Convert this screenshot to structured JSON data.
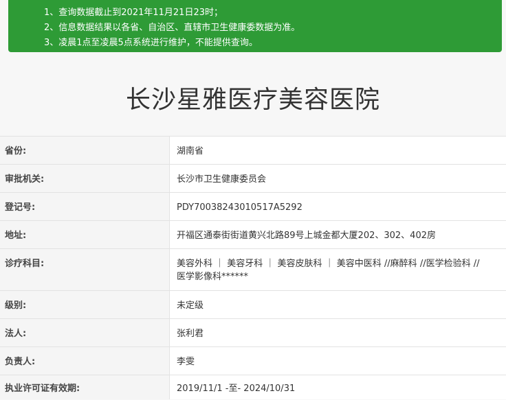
{
  "notice": {
    "lines": [
      "1、查询数据截止到2021年11月21日23时；",
      "2、信息数据结果以各省、自治区、直辖市卫生健康委数据为准。",
      "3、凌晨1点至凌晨5点系统进行维护，不能提供查询。"
    ]
  },
  "title": "长沙星雅医疗美容医院",
  "rows": [
    {
      "label": "省份:",
      "value": "湖南省"
    },
    {
      "label": "审批机关:",
      "value": "长沙市卫生健康委员会"
    },
    {
      "label": "登记号:",
      "value": "PDY70038243010517A5292"
    },
    {
      "label": "地址:",
      "value": "开福区通泰街街道黄兴北路89号上城金都大厦202、302、402房"
    },
    {
      "label": "诊疗科目:",
      "value": "美容外科 ｜ 美容牙科 ｜ 美容皮肤科 ｜ 美容中医科 //麻醉科 //医学检验科 //",
      "value2": "医学影像科******"
    },
    {
      "label": "级别:",
      "value": "未定级"
    },
    {
      "label": "法人:",
      "value": "张利君"
    },
    {
      "label": "负责人:",
      "value": "李雯"
    },
    {
      "label": "执业许可证有效期:",
      "value": "2019/11/1 -至- 2024/10/31"
    }
  ]
}
